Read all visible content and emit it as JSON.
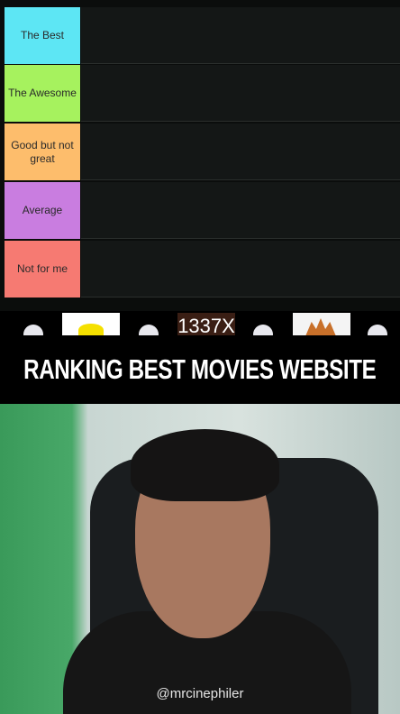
{
  "tiers": [
    {
      "label": "The Best",
      "color": "#5de6f4"
    },
    {
      "label": "The Awesome",
      "color": "#a6f25e"
    },
    {
      "label": "Good but not great",
      "color": "#fdbd6c"
    },
    {
      "label": "Average",
      "color": "#c97de0"
    },
    {
      "label": "Not for me",
      "color": "#f67a72"
    }
  ],
  "strip": {
    "logo_text": "1337X"
  },
  "banner": {
    "title": "RANKING BEST MOVIES WEBSITE"
  },
  "video": {
    "handle": "@mrcinephiler"
  }
}
